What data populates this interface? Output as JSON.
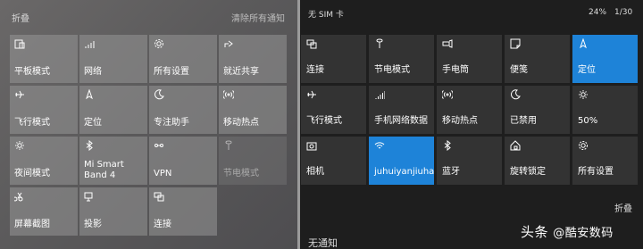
{
  "desktop": {
    "collapse_label": "折叠",
    "clear_all_label": "清除所有通知",
    "tiles": [
      {
        "icon": "tablet-mode-icon",
        "label": "平板模式"
      },
      {
        "icon": "network-icon",
        "label": "网络"
      },
      {
        "icon": "settings-icon",
        "label": "所有设置"
      },
      {
        "icon": "nearby-share-icon",
        "label": "就近共享"
      },
      {
        "icon": "airplane-icon",
        "label": "飞行模式"
      },
      {
        "icon": "location-icon",
        "label": "定位"
      },
      {
        "icon": "focus-assist-icon",
        "label": "专注助手"
      },
      {
        "icon": "hotspot-icon",
        "label": "移动热点"
      },
      {
        "icon": "night-light-icon",
        "label": "夜间模式"
      },
      {
        "icon": "bluetooth-icon",
        "label": "Mi Smart Band 4"
      },
      {
        "icon": "vpn-icon",
        "label": "VPN"
      },
      {
        "icon": "battery-saver-icon",
        "label": "节电模式",
        "dim": true
      },
      {
        "icon": "snip-icon",
        "label": "屏幕截图"
      },
      {
        "icon": "project-icon",
        "label": "投影"
      },
      {
        "icon": "connect-icon",
        "label": "连接"
      }
    ]
  },
  "mobile": {
    "carrier": "无 SIM 卡",
    "battery": "24%",
    "date": "1/30",
    "collapse_label": "折叠",
    "no_notifications": "无通知",
    "watermark": {
      "prefix": "头条",
      "handle": "@酷安数码"
    },
    "tiles": [
      {
        "icon": "connect-icon",
        "label": "连接"
      },
      {
        "icon": "battery-saver-icon",
        "label": "节电模式"
      },
      {
        "icon": "flashlight-icon",
        "label": "手电筒"
      },
      {
        "icon": "note-icon",
        "label": "便笺"
      },
      {
        "icon": "location-icon",
        "label": "定位",
        "on": true
      },
      {
        "icon": "airplane-icon",
        "label": "飞行模式"
      },
      {
        "icon": "cellular-icon",
        "label": "手机网络数据"
      },
      {
        "icon": "hotspot-icon",
        "label": "移动热点"
      },
      {
        "icon": "quiet-hours-icon",
        "label": "已禁用"
      },
      {
        "icon": "brightness-icon",
        "label": "50%"
      },
      {
        "icon": "camera-icon",
        "label": "相机"
      },
      {
        "icon": "wifi-icon",
        "label": "juhuiyanjiuhang",
        "on": true
      },
      {
        "icon": "bluetooth-icon",
        "label": "蓝牙"
      },
      {
        "icon": "rotation-lock-icon",
        "label": "旋转锁定"
      },
      {
        "icon": "settings-icon",
        "label": "所有设置"
      }
    ]
  }
}
